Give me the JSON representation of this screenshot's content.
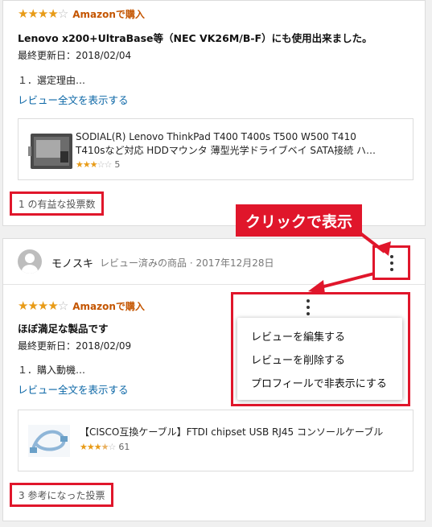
{
  "review1": {
    "rating": 4,
    "badge": "Amazonで購入",
    "title": "Lenovo x200+UltraBase等（NEC VK26M/B-F）にも使用出来ました。",
    "updated": "最終更新日：2018/02/04",
    "excerpt": "１．選定理由…",
    "read_more": "レビュー全文を表示する",
    "product": {
      "name_line1": "SODIAL(R) Lenovo ThinkPad T400 T400s T500 W500 T410",
      "name_line2": "T410sなど対応 HDDマウンタ 薄型光学ドライブベイ SATA接続 ハ…",
      "rating": 3,
      "count": "5"
    },
    "votes": "1 の有益な投票数"
  },
  "annotation": {
    "callout": "クリックで表示",
    "color": "#e0162b"
  },
  "review2": {
    "username": "モノスキ",
    "verified": "レビュー済みの商品 · 2017年12月28日",
    "rating": 4,
    "badge": "Amazonで購入",
    "title": "ほぼ満足な製品です",
    "updated": "最終更新日：2018/02/09",
    "excerpt": "１．購入動機…",
    "read_more": "レビュー全文を表示する",
    "product": {
      "name": "【CISCO互換ケーブル】FTDI chipset USB RJ45 コンソールケーブル",
      "rating": 3.5,
      "count": "61"
    },
    "votes": "3 参考になった投票"
  },
  "menu": {
    "items": [
      {
        "label": "レビューを編集する"
      },
      {
        "label": "レビューを削除する"
      },
      {
        "label": "プロフィールで非表示にする"
      }
    ]
  }
}
